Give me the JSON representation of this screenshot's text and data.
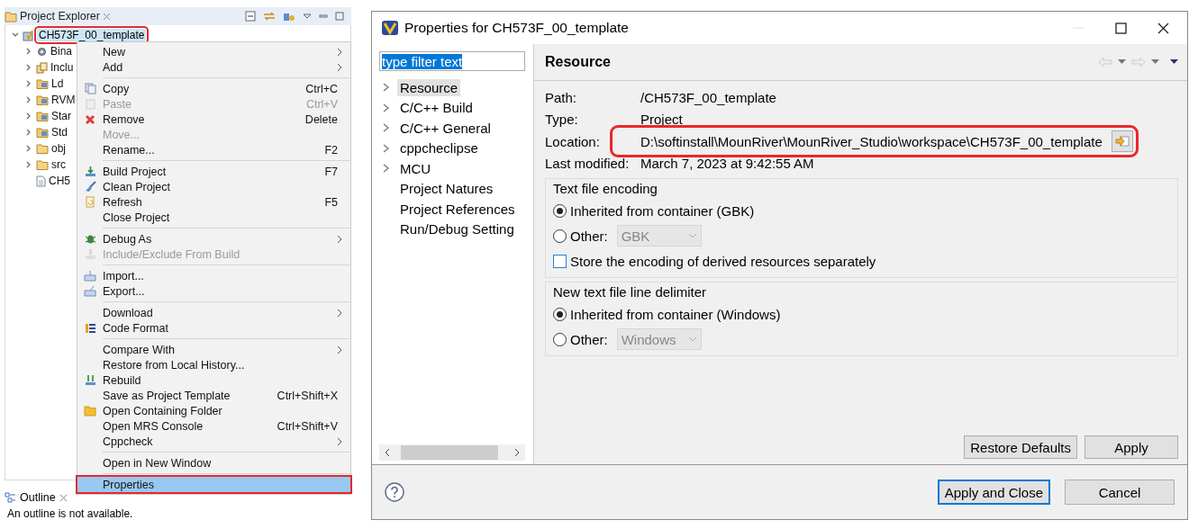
{
  "explorer": {
    "title": "Project Explorer",
    "tree": [
      {
        "kind": "project",
        "label": "CH573F_00_template",
        "expanded": true,
        "annotated": true,
        "children": [
          {
            "kind": "binaries",
            "label": "Bina",
            "expanded": false
          },
          {
            "kind": "includes",
            "label": "Inclu",
            "expanded": false
          },
          {
            "kind": "source-folder",
            "label": "Ld",
            "expanded": false
          },
          {
            "kind": "source-folder",
            "label": "RVM",
            "expanded": false
          },
          {
            "kind": "source-folder",
            "label": "Star",
            "expanded": false
          },
          {
            "kind": "source-folder",
            "label": "Std",
            "expanded": false
          },
          {
            "kind": "folder",
            "label": "obj",
            "expanded": false
          },
          {
            "kind": "folder",
            "label": "src",
            "expanded": false
          },
          {
            "kind": "file",
            "label": "CH5"
          }
        ]
      }
    ]
  },
  "context_menu": {
    "items": [
      {
        "kind": "item",
        "label": "New",
        "submenu": true,
        "disabled": false,
        "selected": false
      },
      {
        "kind": "item",
        "label": "Add",
        "submenu": true,
        "disabled": false,
        "selected": false
      },
      {
        "kind": "separator"
      },
      {
        "kind": "item",
        "label": "Copy",
        "shortcut": "Ctrl+C",
        "submenu": false,
        "disabled": false,
        "selected": false
      },
      {
        "kind": "item",
        "label": "Paste",
        "shortcut": "Ctrl+V",
        "submenu": false,
        "disabled": true,
        "selected": false
      },
      {
        "kind": "item",
        "label": "Remove",
        "shortcut": "Delete",
        "submenu": false,
        "disabled": false,
        "selected": false
      },
      {
        "kind": "item",
        "label": "Move...",
        "submenu": false,
        "disabled": true,
        "selected": false
      },
      {
        "kind": "item",
        "label": "Rename...",
        "shortcut": "F2",
        "submenu": false,
        "disabled": false,
        "selected": false
      },
      {
        "kind": "separator"
      },
      {
        "kind": "item",
        "label": "Build Project",
        "shortcut": "F7",
        "submenu": false,
        "disabled": false,
        "selected": false
      },
      {
        "kind": "item",
        "label": "Clean Project",
        "submenu": false,
        "disabled": false,
        "selected": false
      },
      {
        "kind": "item",
        "label": "Refresh",
        "shortcut": "F5",
        "submenu": false,
        "disabled": false,
        "selected": false
      },
      {
        "kind": "item",
        "label": "Close Project",
        "submenu": false,
        "disabled": false,
        "selected": false
      },
      {
        "kind": "separator"
      },
      {
        "kind": "item",
        "label": "Debug As",
        "submenu": true,
        "disabled": false,
        "selected": false
      },
      {
        "kind": "item",
        "label": "Include/Exclude From Build",
        "submenu": false,
        "disabled": true,
        "selected": false
      },
      {
        "kind": "separator"
      },
      {
        "kind": "item",
        "label": "Import...",
        "submenu": false,
        "disabled": false,
        "selected": false
      },
      {
        "kind": "item",
        "label": "Export...",
        "submenu": false,
        "disabled": false,
        "selected": false
      },
      {
        "kind": "separator"
      },
      {
        "kind": "item",
        "label": "Download",
        "submenu": true,
        "disabled": false,
        "selected": false
      },
      {
        "kind": "item",
        "label": "Code Format",
        "submenu": false,
        "disabled": false,
        "selected": false
      },
      {
        "kind": "separator"
      },
      {
        "kind": "item",
        "label": "Compare With",
        "submenu": true,
        "disabled": false,
        "selected": false
      },
      {
        "kind": "item",
        "label": "Restore from Local History...",
        "submenu": false,
        "disabled": false,
        "selected": false
      },
      {
        "kind": "item",
        "label": "Rebuild",
        "submenu": false,
        "disabled": false,
        "selected": false
      },
      {
        "kind": "item",
        "label": "Save as Project Template",
        "shortcut": "Ctrl+Shift+X",
        "submenu": false,
        "disabled": false,
        "selected": false
      },
      {
        "kind": "item",
        "label": "Open Containing Folder",
        "submenu": false,
        "disabled": false,
        "selected": false
      },
      {
        "kind": "item",
        "label": "Open MRS Console",
        "shortcut": "Ctrl+Shift+V",
        "submenu": false,
        "disabled": false,
        "selected": false
      },
      {
        "kind": "item",
        "label": "Cppcheck",
        "submenu": true,
        "disabled": false,
        "selected": false
      },
      {
        "kind": "separator"
      },
      {
        "kind": "item",
        "label": "Open in New Window",
        "submenu": false,
        "disabled": false,
        "selected": false
      },
      {
        "kind": "separator"
      },
      {
        "kind": "item",
        "label": "Properties",
        "submenu": false,
        "disabled": false,
        "selected": true,
        "annotated": true
      }
    ]
  },
  "outline": {
    "title": "Outline",
    "message": "An outline is not available."
  },
  "dialog": {
    "title": "Properties for CH573F_00_template",
    "filter": {
      "value": "type filter text",
      "text_selected": true
    },
    "nav": [
      {
        "label": "Resource",
        "has_children": true,
        "selected": true
      },
      {
        "label": "C/C++ Build",
        "has_children": true,
        "selected": false
      },
      {
        "label": "C/C++ General",
        "has_children": true,
        "selected": false
      },
      {
        "label": "cppcheclipse",
        "has_children": true,
        "selected": false
      },
      {
        "label": "MCU",
        "has_children": true,
        "selected": false
      },
      {
        "label": "Project Natures",
        "has_children": false,
        "selected": false
      },
      {
        "label": "Project References",
        "has_children": false,
        "selected": false
      },
      {
        "label": "Run/Debug Setting",
        "has_children": false,
        "selected": false
      }
    ],
    "page": {
      "title": "Resource",
      "fields": [
        {
          "label": "Path:",
          "value": "/CH573F_00_template",
          "annotated": false
        },
        {
          "label": "Type:",
          "value": "Project",
          "annotated": false
        },
        {
          "label": "Location:",
          "value": "D:\\softinstall\\MounRiver\\MounRiver_Studio\\workspace\\CH573F_00_template",
          "annotated": true,
          "browse": true
        },
        {
          "label": "Last modified:",
          "value": "March 7, 2023 at 9:42:55 AM",
          "annotated": false
        }
      ],
      "groups": [
        {
          "title": "Text file encoding",
          "options": [
            {
              "kind": "radio",
              "label": "Inherited from container (GBK)",
              "selected": true
            },
            {
              "kind": "radio",
              "label": "Other:",
              "selected": false,
              "combo": {
                "value": "GBK",
                "disabled": true
              }
            },
            {
              "kind": "checkbox",
              "label": "Store the encoding of derived resources separately",
              "checked": false
            }
          ]
        },
        {
          "title": "New text file line delimiter",
          "options": [
            {
              "kind": "radio",
              "label": "Inherited from container (Windows)",
              "selected": true
            },
            {
              "kind": "radio",
              "label": "Other:",
              "selected": false,
              "combo": {
                "value": "Windows",
                "disabled": true
              }
            }
          ]
        }
      ],
      "buttons": [
        {
          "label": "Restore Defaults"
        },
        {
          "label": "Apply"
        }
      ]
    },
    "buttons": [
      {
        "label": "Apply and Close",
        "default": true
      },
      {
        "label": "Cancel",
        "default": false
      }
    ]
  }
}
